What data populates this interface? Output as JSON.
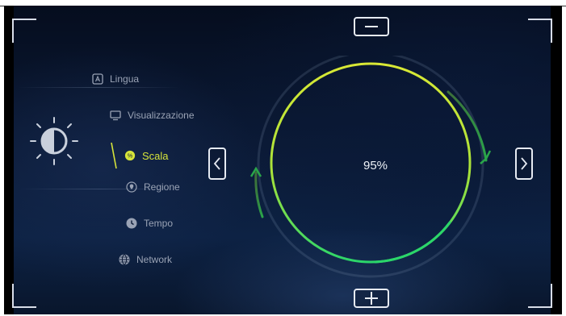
{
  "menu": {
    "items": [
      {
        "label": "Lingua",
        "icon": "language-icon"
      },
      {
        "label": "Visualizzazione",
        "icon": "monitor-icon"
      },
      {
        "label": "Scala",
        "icon": "scale-icon",
        "active": true
      },
      {
        "label": "Regione",
        "icon": "location-pin-icon"
      },
      {
        "label": "Tempo",
        "icon": "clock-icon"
      },
      {
        "label": "Network",
        "icon": "globe-icon"
      }
    ]
  },
  "scale": {
    "value_label": "95%",
    "value": 0.95,
    "decrease_label": "−",
    "increase_label": "+",
    "prev_label": "<",
    "next_label": ">"
  },
  "colors": {
    "accent": "#d6e43a",
    "ring_start": "#d9e835",
    "ring_end": "#2bd66a",
    "inactive_text": "#9aa3b5"
  }
}
